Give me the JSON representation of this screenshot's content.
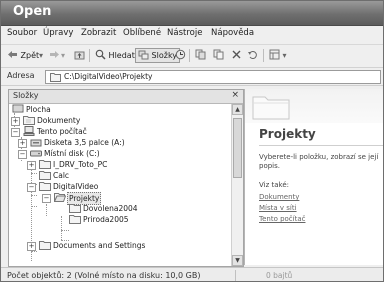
{
  "window": {
    "title": "Open"
  },
  "menu": [
    "Soubor",
    "Úpravy",
    "Zobrazit",
    "Oblíbené",
    "Nástroje",
    "Nápověda"
  ],
  "toolbar": {
    "back_label": "Zpět",
    "search_label": "Hledat",
    "folders_label": "Složky"
  },
  "address": {
    "label": "Adresa",
    "value": "C:\\DigitalVideo\\Projekty"
  },
  "folders_pane": {
    "title": "Složky",
    "close_glyph": "×"
  },
  "tree": [
    {
      "label": "Plocha"
    },
    {
      "label": "Dokumenty"
    },
    {
      "label": "Tento počítač"
    },
    {
      "label": "Disketa 3,5 palce (A:)"
    },
    {
      "label": "Místní disk (C:)"
    },
    {
      "label": "I_DRV_Toto_PC"
    },
    {
      "label": "Calc"
    },
    {
      "label": "DigitalVideo"
    },
    {
      "label": "Projekty"
    },
    {
      "label": "Dovolena2004"
    },
    {
      "label": "Priroda2005"
    },
    {
      "label": "Documents and Settings"
    }
  ],
  "details": {
    "title": "Projekty",
    "description_line1": "Vyberete-li položku, zobrazí se její",
    "description_line2": "popis.",
    "see_also": "Viz také:",
    "links": [
      "Dokumenty",
      "Místa v síti",
      "Tento počítač"
    ]
  },
  "status": {
    "text": "Počet objektů: 2 (Volné místo na disku: 10,0 GB)",
    "size": "0 bajtů"
  }
}
